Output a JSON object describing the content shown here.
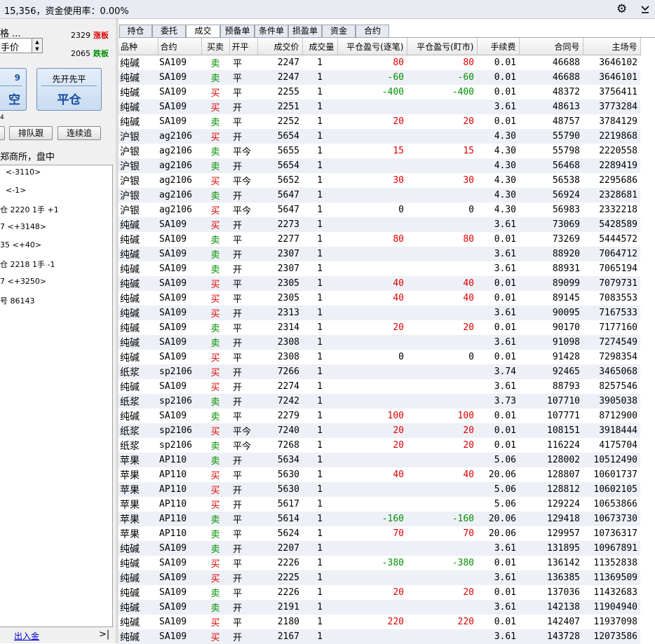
{
  "topbar": {
    "status": "15,356，资金使用率：0.00%",
    "settings_icon": "gear-icon",
    "menu_icon": "chevron-down-icon"
  },
  "left_panel": {
    "price_label": "格 ...",
    "price_type": "手价",
    "limit_up_value": "2329",
    "limit_up_label": "涨板",
    "limit_down_value": "2065",
    "limit_down_label": "跌板",
    "btn_left_top": "9",
    "btn_left_bottom": "空",
    "btn_right_top": "先开先平",
    "btn_right_bottom": "平仓",
    "small_label": "4",
    "btn_partial": "",
    "btn_queue": "排队跟",
    "btn_chase": "连续追",
    "exchange_status": "郑商所，盘中",
    "box_lines": [
      "<-3110>",
      "<-1>",
      "仓  2220  1手  +1",
      "7  <+3148>",
      "35  <+40>",
      "仓  2218  1手  -1",
      "7  <+3250>",
      "号  86143"
    ],
    "deposit_link": "出入金",
    "collapse_icon": ">|"
  },
  "tabs": [
    {
      "label": "持仓",
      "active": false
    },
    {
      "label": "委托",
      "active": false
    },
    {
      "label": "成交",
      "active": true
    },
    {
      "label": "预备单",
      "active": false
    },
    {
      "label": "条件单",
      "active": false
    },
    {
      "label": "损盈单",
      "active": false
    },
    {
      "label": "资金",
      "active": false
    },
    {
      "label": "合约",
      "active": false
    }
  ],
  "table": {
    "headers": [
      "品种",
      "合约",
      "买卖",
      "开平",
      "成交价",
      "成交量",
      "平仓盈亏(逐笔)",
      "平仓盈亏(盯市)",
      "手续费",
      "合同号",
      "主场号"
    ],
    "rows": [
      [
        "纯碱",
        "SA109",
        "卖",
        "平",
        "2247",
        "1",
        "80",
        "80",
        "0.01",
        "46688",
        "3646102"
      ],
      [
        "纯碱",
        "SA109",
        "卖",
        "平",
        "2247",
        "1",
        "-60",
        "-60",
        "0.01",
        "46688",
        "3646101"
      ],
      [
        "纯碱",
        "SA109",
        "买",
        "平",
        "2255",
        "1",
        "-400",
        "-400",
        "0.01",
        "48372",
        "3756411"
      ],
      [
        "纯碱",
        "SA109",
        "买",
        "开",
        "2251",
        "1",
        "",
        "",
        "3.61",
        "48613",
        "3773284"
      ],
      [
        "纯碱",
        "SA109",
        "卖",
        "平",
        "2252",
        "1",
        "20",
        "20",
        "0.01",
        "48757",
        "3784129"
      ],
      [
        "沪银",
        "ag2106",
        "买",
        "开",
        "5654",
        "1",
        "",
        "",
        "4.30",
        "55790",
        "2219868"
      ],
      [
        "沪银",
        "ag2106",
        "卖",
        "平今",
        "5655",
        "1",
        "15",
        "15",
        "4.30",
        "55798",
        "2220558"
      ],
      [
        "沪银",
        "ag2106",
        "卖",
        "开",
        "5654",
        "1",
        "",
        "",
        "4.30",
        "56468",
        "2289419"
      ],
      [
        "沪银",
        "ag2106",
        "买",
        "平今",
        "5652",
        "1",
        "30",
        "30",
        "4.30",
        "56538",
        "2295686"
      ],
      [
        "沪银",
        "ag2106",
        "卖",
        "开",
        "5647",
        "1",
        "",
        "",
        "4.30",
        "56924",
        "2328681"
      ],
      [
        "沪银",
        "ag2106",
        "买",
        "平今",
        "5647",
        "1",
        "0",
        "0",
        "4.30",
        "56983",
        "2332218"
      ],
      [
        "纯碱",
        "SA109",
        "买",
        "开",
        "2273",
        "1",
        "",
        "",
        "3.61",
        "73069",
        "5428589"
      ],
      [
        "纯碱",
        "SA109",
        "卖",
        "平",
        "2277",
        "1",
        "80",
        "80",
        "0.01",
        "73269",
        "5444572"
      ],
      [
        "纯碱",
        "SA109",
        "卖",
        "开",
        "2307",
        "1",
        "",
        "",
        "3.61",
        "88920",
        "7064712"
      ],
      [
        "纯碱",
        "SA109",
        "卖",
        "开",
        "2307",
        "1",
        "",
        "",
        "3.61",
        "88931",
        "7065194"
      ],
      [
        "纯碱",
        "SA109",
        "买",
        "平",
        "2305",
        "1",
        "40",
        "40",
        "0.01",
        "89099",
        "7079731"
      ],
      [
        "纯碱",
        "SA109",
        "买",
        "平",
        "2305",
        "1",
        "40",
        "40",
        "0.01",
        "89145",
        "7083553"
      ],
      [
        "纯碱",
        "SA109",
        "买",
        "开",
        "2313",
        "1",
        "",
        "",
        "3.61",
        "90095",
        "7167533"
      ],
      [
        "纯碱",
        "SA109",
        "卖",
        "平",
        "2314",
        "1",
        "20",
        "20",
        "0.01",
        "90170",
        "7177160"
      ],
      [
        "纯碱",
        "SA109",
        "卖",
        "开",
        "2308",
        "1",
        "",
        "",
        "3.61",
        "91098",
        "7274549"
      ],
      [
        "纯碱",
        "SA109",
        "买",
        "平",
        "2308",
        "1",
        "0",
        "0",
        "0.01",
        "91428",
        "7298354"
      ],
      [
        "纸浆",
        "sp2106",
        "买",
        "开",
        "7266",
        "1",
        "",
        "",
        "3.74",
        "92465",
        "3465068"
      ],
      [
        "纯碱",
        "SA109",
        "买",
        "开",
        "2274",
        "1",
        "",
        "",
        "3.61",
        "88793",
        "8257546"
      ],
      [
        "纸浆",
        "sp2106",
        "卖",
        "开",
        "7242",
        "1",
        "",
        "",
        "3.73",
        "107710",
        "3905038"
      ],
      [
        "纯碱",
        "SA109",
        "卖",
        "平",
        "2279",
        "1",
        "100",
        "100",
        "0.01",
        "107771",
        "8712900"
      ],
      [
        "纸浆",
        "sp2106",
        "买",
        "平今",
        "7240",
        "1",
        "20",
        "20",
        "0.01",
        "108151",
        "3918444"
      ],
      [
        "纸浆",
        "sp2106",
        "卖",
        "平今",
        "7268",
        "1",
        "20",
        "20",
        "0.01",
        "116224",
        "4175704"
      ],
      [
        "苹果",
        "AP110",
        "卖",
        "开",
        "5634",
        "1",
        "",
        "",
        "5.06",
        "128002",
        "10512490"
      ],
      [
        "苹果",
        "AP110",
        "买",
        "平",
        "5630",
        "1",
        "40",
        "40",
        "20.06",
        "128807",
        "10601737"
      ],
      [
        "苹果",
        "AP110",
        "买",
        "开",
        "5630",
        "1",
        "",
        "",
        "5.06",
        "128812",
        "10602105"
      ],
      [
        "苹果",
        "AP110",
        "买",
        "开",
        "5617",
        "1",
        "",
        "",
        "5.06",
        "129224",
        "10653866"
      ],
      [
        "苹果",
        "AP110",
        "卖",
        "平",
        "5614",
        "1",
        "-160",
        "-160",
        "20.06",
        "129418",
        "10673730"
      ],
      [
        "苹果",
        "AP110",
        "卖",
        "平",
        "5624",
        "1",
        "70",
        "70",
        "20.06",
        "129957",
        "10736317"
      ],
      [
        "纯碱",
        "SA109",
        "卖",
        "开",
        "2207",
        "1",
        "",
        "",
        "3.61",
        "131895",
        "10967891"
      ],
      [
        "纯碱",
        "SA109",
        "买",
        "平",
        "2226",
        "1",
        "-380",
        "-380",
        "0.01",
        "136142",
        "11352838"
      ],
      [
        "纯碱",
        "SA109",
        "买",
        "开",
        "2225",
        "1",
        "",
        "",
        "3.61",
        "136385",
        "11369509"
      ],
      [
        "纯碱",
        "SA109",
        "卖",
        "平",
        "2226",
        "1",
        "20",
        "20",
        "0.01",
        "137036",
        "11432683"
      ],
      [
        "纯碱",
        "SA109",
        "卖",
        "开",
        "2191",
        "1",
        "",
        "",
        "3.61",
        "142138",
        "11904940"
      ],
      [
        "纯碱",
        "SA109",
        "买",
        "平",
        "2180",
        "1",
        "220",
        "220",
        "0.01",
        "142407",
        "11937098"
      ],
      [
        "纯碱",
        "SA109",
        "买",
        "开",
        "2167",
        "1",
        "",
        "",
        "3.61",
        "143728",
        "12073586"
      ]
    ]
  },
  "colors": {
    "buy": "#e00000",
    "sell": "#009000",
    "profit": "#e00000",
    "loss": "#009000",
    "row_alt": "#eef0f7"
  }
}
